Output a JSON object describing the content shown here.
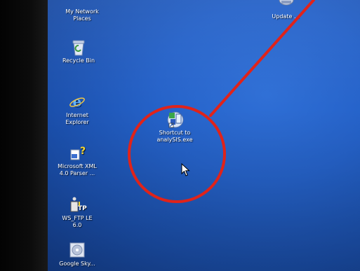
{
  "desktop_icons": [
    {
      "label": "My Network\nPlaces",
      "icon": "network-places-icon"
    },
    {
      "label": "Recycle Bin",
      "icon": "recycle-bin-icon"
    },
    {
      "label": "Internet\nExplorer",
      "icon": "internet-explorer-icon"
    },
    {
      "label": "Microsoft XML\n4.0 Parser ...",
      "icon": "xml-parser-icon"
    },
    {
      "label": "WS_FTP LE\n6.0",
      "icon": "ws-ftp-icon"
    },
    {
      "label": "Google Sky...",
      "icon": "disc-icon"
    },
    {
      "label": "Update ...",
      "icon": "update-icon"
    },
    {
      "label": "Shortcut to\nanalySIS.exe",
      "icon": "analysis-shortcut-icon"
    }
  ],
  "colors": {
    "desktop_blue": "#2562c9",
    "annotation_red": "#e0231a"
  }
}
